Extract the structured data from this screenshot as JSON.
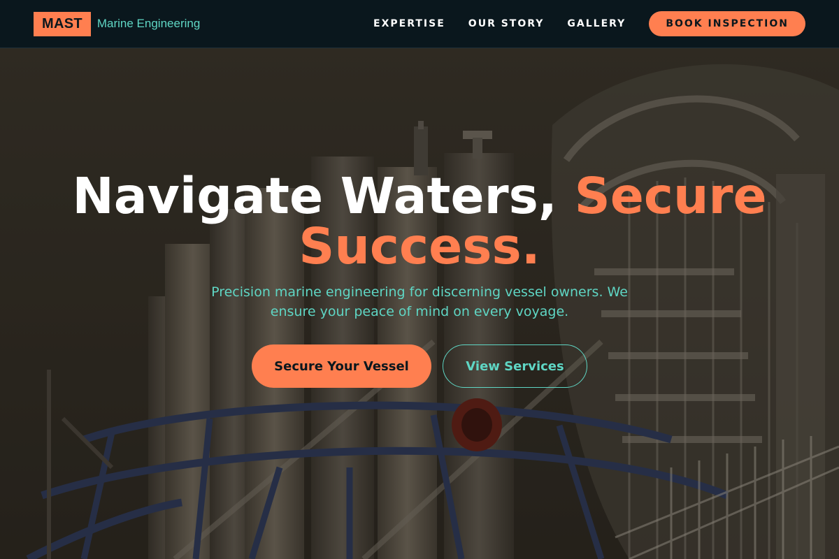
{
  "header": {
    "logo_mark": "MAST",
    "logo_sub": "Marine Engineering",
    "nav": [
      {
        "label": "EXPERTISE"
      },
      {
        "label": "OUR STORY"
      },
      {
        "label": "GALLERY"
      }
    ],
    "cta_label": "BOOK INSPECTION"
  },
  "hero": {
    "headline_part1": "Navigate Waters, ",
    "headline_accent": "Secure Success.",
    "subheadline": "Precision marine engineering for discerning vessel owners. We ensure your peace of mind on every voyage.",
    "primary_cta": "Secure Your Vessel",
    "secondary_cta": "View Services",
    "background_image": "ship-deck-spiral-staircase-photo"
  },
  "colors": {
    "accent": "#ff7f50",
    "teal": "#5fd6c4",
    "header_bg": "#0a171d",
    "text": "#ffffff"
  }
}
